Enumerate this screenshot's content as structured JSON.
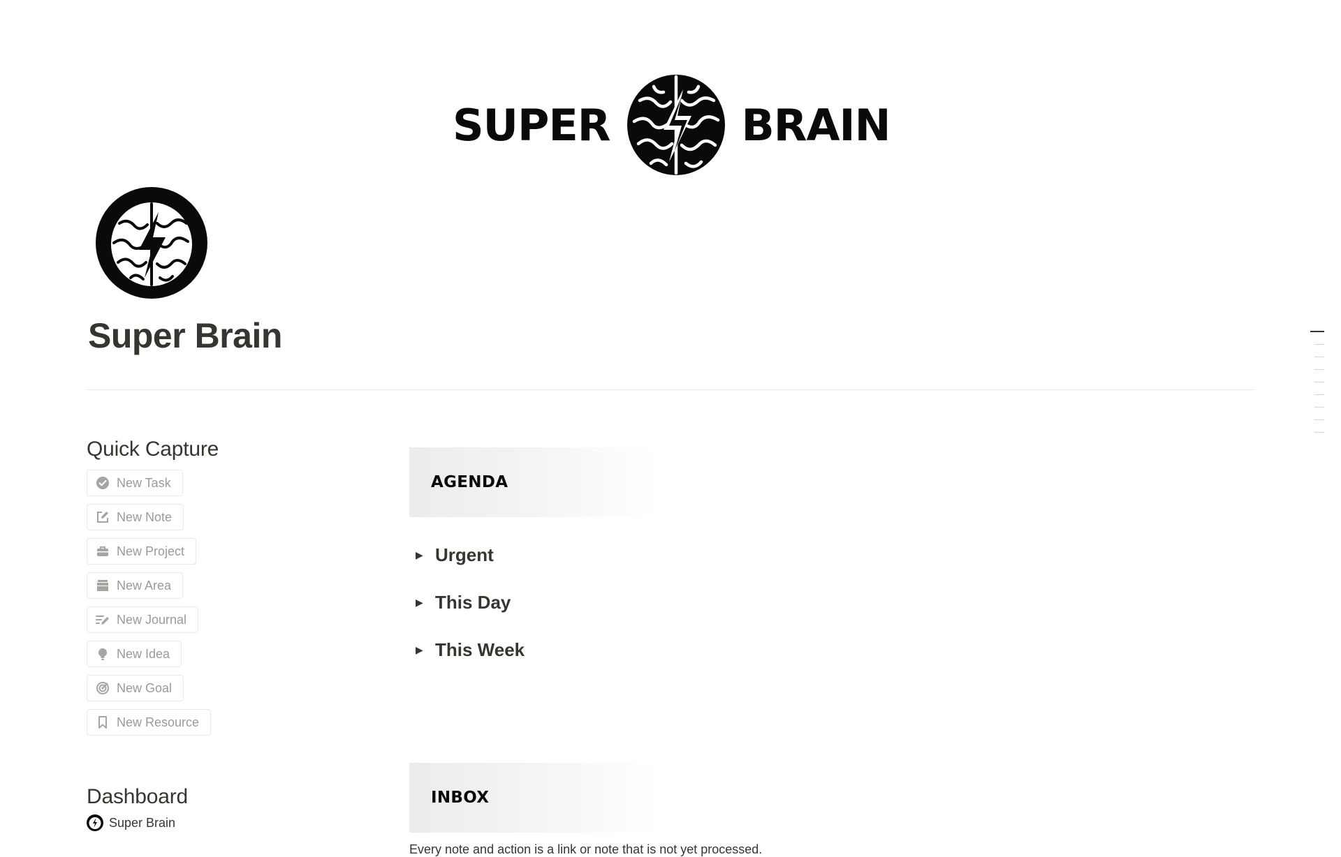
{
  "banner": {
    "word_left": "SUPER",
    "word_right": "BRAIN",
    "logo_icon": "brain-lightning-icon"
  },
  "page": {
    "title": "Super Brain",
    "icon": "brain-lightning-icon"
  },
  "quick_capture": {
    "heading": "Quick Capture",
    "buttons": [
      {
        "label": "New Task",
        "icon": "check-circle-icon"
      },
      {
        "label": "New Note",
        "icon": "edit-icon"
      },
      {
        "label": "New Project",
        "icon": "briefcase-icon"
      },
      {
        "label": "New Area",
        "icon": "archive-icon"
      },
      {
        "label": "New Journal",
        "icon": "journal-pen-icon"
      },
      {
        "label": "New Idea",
        "icon": "lightbulb-icon"
      },
      {
        "label": "New Goal",
        "icon": "target-icon"
      },
      {
        "label": "New Resource",
        "icon": "bookmark-icon"
      }
    ]
  },
  "dashboard": {
    "heading": "Dashboard",
    "items": [
      {
        "label": "Super Brain",
        "icon": "brain-lightning-icon"
      }
    ]
  },
  "agenda": {
    "title": "AGENDA",
    "toggles": [
      {
        "label": "Urgent"
      },
      {
        "label": "This Day"
      },
      {
        "label": "This Week"
      }
    ]
  },
  "inbox": {
    "title": "INBOX",
    "text": "Every note and action is a link or note that is not yet processed."
  },
  "colors": {
    "text": "#37352f",
    "muted": "#9b9a97",
    "border": "#e9e9e7",
    "logo": "#0a0a0a"
  }
}
